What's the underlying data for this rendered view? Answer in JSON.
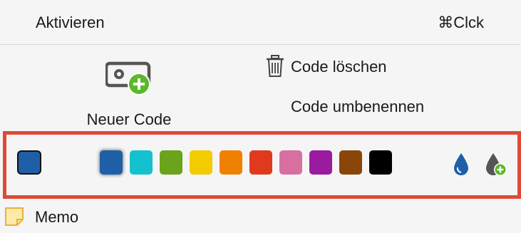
{
  "activate": {
    "label": "Aktivieren",
    "shortcut": "⌘Clck"
  },
  "actions": {
    "new_code": "Neuer Code",
    "delete_code": "Code löschen",
    "rename_code": "Code umbenennen"
  },
  "color_bar": {
    "current_color": "#1f5fa8",
    "swatches": [
      {
        "name": "blue",
        "color": "#1f5fa8",
        "selected": true
      },
      {
        "name": "cyan",
        "color": "#14c2cf",
        "selected": false
      },
      {
        "name": "green",
        "color": "#6aa31c",
        "selected": false
      },
      {
        "name": "yellow",
        "color": "#f2cb00",
        "selected": false
      },
      {
        "name": "orange",
        "color": "#f08000",
        "selected": false
      },
      {
        "name": "red",
        "color": "#e03a1e",
        "selected": false
      },
      {
        "name": "pink",
        "color": "#d770a1",
        "selected": false
      },
      {
        "name": "purple",
        "color": "#9a1aa0",
        "selected": false
      },
      {
        "name": "brown",
        "color": "#8b4508",
        "selected": false
      },
      {
        "name": "black",
        "color": "#000000",
        "selected": false
      }
    ],
    "icons": [
      "ink-drop-icon",
      "add-color-drop-icon"
    ],
    "accent_green": "#5ab82a",
    "outline_color": "#de4a37"
  },
  "memo": {
    "label": "Memo",
    "icon": "memo-note-icon",
    "icon_color": "#fde9a8"
  }
}
